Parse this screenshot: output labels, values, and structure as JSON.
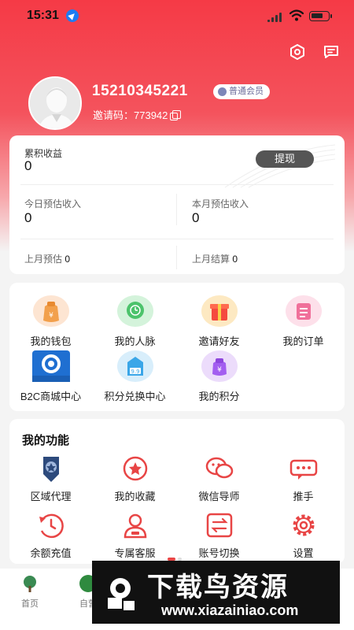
{
  "status_bar": {
    "time": "15:31"
  },
  "profile": {
    "phone": "15210345221",
    "member_badge": "普通会员",
    "invite_label": "邀请码：",
    "invite_code": "773942"
  },
  "earnings": {
    "total_label": "累积收益",
    "total_value": "0",
    "withdraw_label": "提现",
    "today_label": "今日预估收入",
    "today_value": "0",
    "month_label": "本月预估收入",
    "month_value": "0",
    "last_month_est_label": "上月预估",
    "last_month_est_value": "0",
    "last_month_settle_label": "上月结算",
    "last_month_settle_value": "0"
  },
  "menu": {
    "items": [
      {
        "label": "我的钱包",
        "icon": "wallet-icon"
      },
      {
        "label": "我的人脉",
        "icon": "network-icon"
      },
      {
        "label": "邀请好友",
        "icon": "gift-icon"
      },
      {
        "label": "我的订单",
        "icon": "order-icon"
      },
      {
        "label": "B2C商城中心",
        "icon": "b2c-mall-icon",
        "icon_caption": "共享云商平台"
      },
      {
        "label": "积分兑换中心",
        "icon": "points-exchange-icon",
        "icon_text": "9.9"
      },
      {
        "label": "我的积分",
        "icon": "points-icon"
      }
    ]
  },
  "functions": {
    "title": "我的功能",
    "items": [
      {
        "label": "区域代理",
        "icon": "region-agent-icon"
      },
      {
        "label": "我的收藏",
        "icon": "favorite-icon"
      },
      {
        "label": "微信导师",
        "icon": "wechat-mentor-icon"
      },
      {
        "label": "推手",
        "icon": "promoter-icon"
      },
      {
        "label": "余额充值",
        "icon": "recharge-icon"
      },
      {
        "label": "专属客服",
        "icon": "customer-service-icon"
      },
      {
        "label": "账号切换",
        "icon": "switch-account-icon"
      },
      {
        "label": "设置",
        "icon": "settings-icon"
      }
    ]
  },
  "tabbar": {
    "items": [
      {
        "label": "首页",
        "icon": "home-tree-icon"
      },
      {
        "label": "自营",
        "icon": "self-operated-icon"
      }
    ]
  },
  "watermark": {
    "title": "下载鸟资源",
    "url": "www.xiazainiao.com"
  },
  "colors": {
    "brand_red": "#f53a46",
    "withdraw_button": "#555555",
    "badge_text": "#6b6b9a"
  }
}
